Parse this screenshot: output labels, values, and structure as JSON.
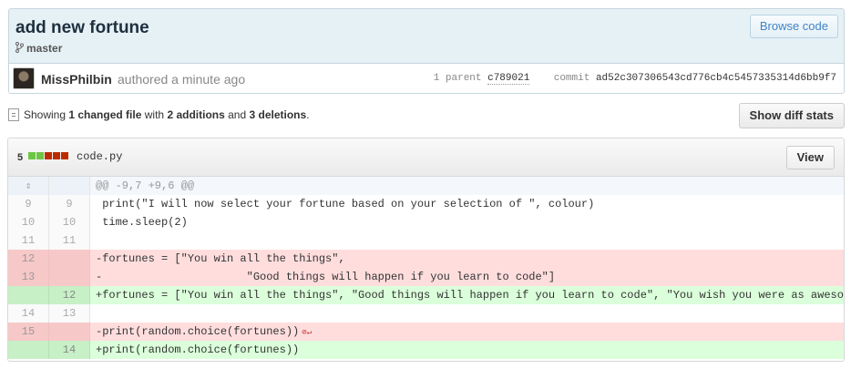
{
  "commit": {
    "title": "add new fortune",
    "branch": "master",
    "browse_label": "Browse code",
    "author": "MissPhilbin",
    "authored": "authored a minute ago",
    "parent_label": "1 parent",
    "parent_sha": "c789021",
    "commit_label": "commit",
    "commit_sha": "ad52c307306543cd776cb4c5457335314d6bb9f7"
  },
  "summary": {
    "prefix": "Showing",
    "changed": "1 changed file",
    "with": "with",
    "additions": "2 additions",
    "and": "and",
    "deletions": "3 deletions",
    "end": ".",
    "diff_stats_label": "Show diff stats"
  },
  "file": {
    "count": "5",
    "name": "code.py",
    "view_label": "View",
    "diffstat": [
      "add",
      "add",
      "del",
      "del",
      "del"
    ],
    "colors": {
      "add": "#6cc644",
      "del": "#bd2c00"
    }
  },
  "diff": {
    "hunk": "@@ -9,7 +9,6 @@",
    "lines": [
      {
        "type": "ctx",
        "old": "9",
        "new": "9",
        "code": " print(\"I will now select your fortune based on your selection of \", colour)"
      },
      {
        "type": "ctx",
        "old": "10",
        "new": "10",
        "code": " time.sleep(2)"
      },
      {
        "type": "ctx",
        "old": "11",
        "new": "11",
        "code": ""
      },
      {
        "type": "del",
        "old": "12",
        "new": "",
        "code": "-fortunes = [\"You win all the things\","
      },
      {
        "type": "del",
        "old": "13",
        "new": "",
        "code": "-                      \"Good things will happen if you learn to code\"]"
      },
      {
        "type": "add",
        "old": "",
        "new": "12",
        "code": "+fortunes = [\"You win all the things\", \"Good things will happen if you learn to code\", \"You wish you were as awesome a"
      },
      {
        "type": "ctx",
        "old": "14",
        "new": "13",
        "code": ""
      },
      {
        "type": "del",
        "old": "15",
        "new": "",
        "code": "-print(random.choice(fortunes))"
      },
      {
        "type": "add",
        "old": "",
        "new": "14",
        "code": "+print(random.choice(fortunes))"
      }
    ]
  }
}
